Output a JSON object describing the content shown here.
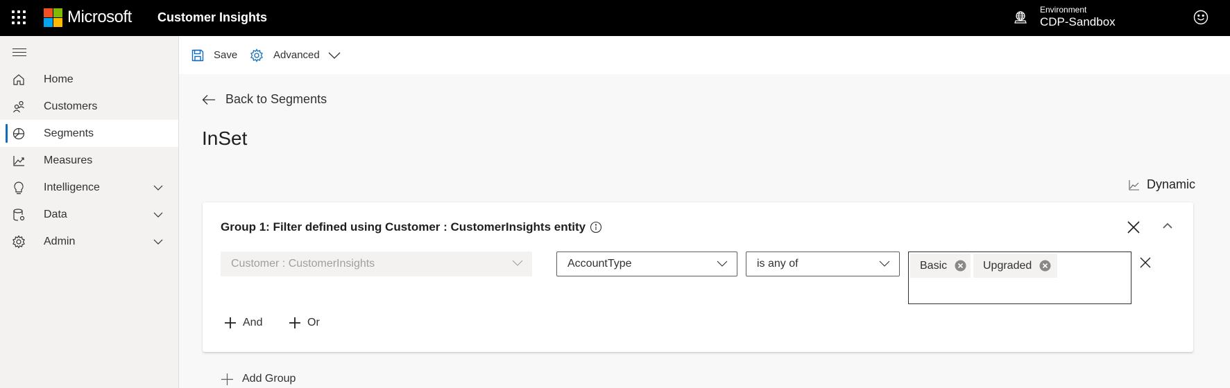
{
  "topbar": {
    "brand": "Microsoft",
    "app_title": "Customer Insights",
    "environment_label": "Environment",
    "environment_value": "CDP-Sandbox",
    "logo_colors": [
      "#f25022",
      "#7fba00",
      "#00a4ef",
      "#ffb900"
    ]
  },
  "sidebar": {
    "items": [
      {
        "label": "Home",
        "icon": "home-icon",
        "active": false,
        "expandable": false
      },
      {
        "label": "Customers",
        "icon": "people-icon",
        "active": false,
        "expandable": false
      },
      {
        "label": "Segments",
        "icon": "pie-chart-icon",
        "active": true,
        "expandable": false
      },
      {
        "label": "Measures",
        "icon": "line-chart-icon",
        "active": false,
        "expandable": false
      },
      {
        "label": "Intelligence",
        "icon": "lightbulb-icon",
        "active": false,
        "expandable": true
      },
      {
        "label": "Data",
        "icon": "database-gear-icon",
        "active": false,
        "expandable": true
      },
      {
        "label": "Admin",
        "icon": "gear-icon",
        "active": false,
        "expandable": true
      }
    ]
  },
  "toolbar": {
    "save_label": "Save",
    "advanced_label": "Advanced"
  },
  "page": {
    "back_label": "Back to Segments",
    "title": "InSet",
    "segment_type": "Dynamic"
  },
  "group": {
    "title": "Group 1: Filter defined using Customer : CustomerInsights entity",
    "entity_select": "Customer : CustomerInsights",
    "attribute_select": "AccountType",
    "operator_select": "is any of",
    "values": [
      "Basic",
      "Upgraded"
    ],
    "and_label": "And",
    "or_label": "Or"
  },
  "add_group_label": "Add Group",
  "colors": {
    "accent": "#0f6cbd",
    "topbar_bg": "#000000",
    "sidebar_bg": "#f3f2f1",
    "content_bg": "#f8f8f8"
  }
}
